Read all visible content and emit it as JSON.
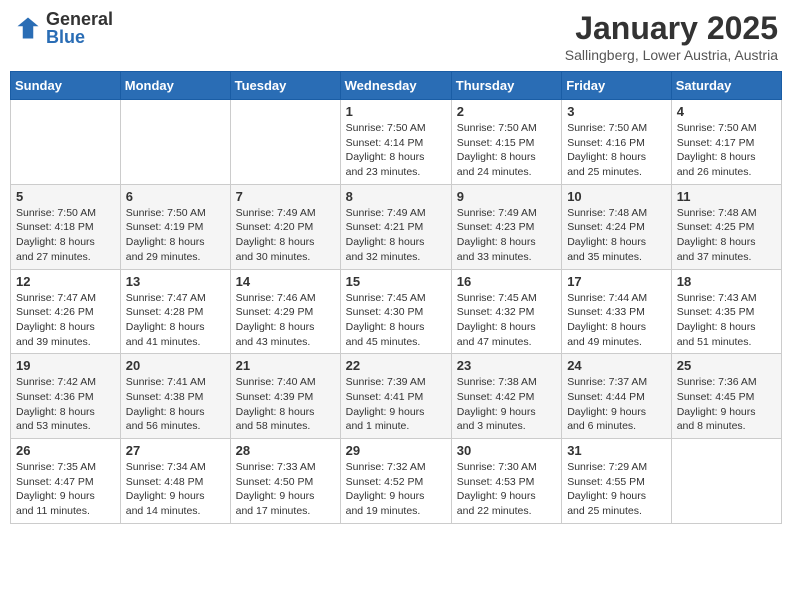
{
  "header": {
    "logo_general": "General",
    "logo_blue": "Blue",
    "month_title": "January 2025",
    "location": "Sallingberg, Lower Austria, Austria"
  },
  "weekdays": [
    "Sunday",
    "Monday",
    "Tuesday",
    "Wednesday",
    "Thursday",
    "Friday",
    "Saturday"
  ],
  "weeks": [
    [
      {
        "day": null,
        "info": null
      },
      {
        "day": null,
        "info": null
      },
      {
        "day": null,
        "info": null
      },
      {
        "day": "1",
        "info": "Sunrise: 7:50 AM\nSunset: 4:14 PM\nDaylight: 8 hours\nand 23 minutes."
      },
      {
        "day": "2",
        "info": "Sunrise: 7:50 AM\nSunset: 4:15 PM\nDaylight: 8 hours\nand 24 minutes."
      },
      {
        "day": "3",
        "info": "Sunrise: 7:50 AM\nSunset: 4:16 PM\nDaylight: 8 hours\nand 25 minutes."
      },
      {
        "day": "4",
        "info": "Sunrise: 7:50 AM\nSunset: 4:17 PM\nDaylight: 8 hours\nand 26 minutes."
      }
    ],
    [
      {
        "day": "5",
        "info": "Sunrise: 7:50 AM\nSunset: 4:18 PM\nDaylight: 8 hours\nand 27 minutes."
      },
      {
        "day": "6",
        "info": "Sunrise: 7:50 AM\nSunset: 4:19 PM\nDaylight: 8 hours\nand 29 minutes."
      },
      {
        "day": "7",
        "info": "Sunrise: 7:49 AM\nSunset: 4:20 PM\nDaylight: 8 hours\nand 30 minutes."
      },
      {
        "day": "8",
        "info": "Sunrise: 7:49 AM\nSunset: 4:21 PM\nDaylight: 8 hours\nand 32 minutes."
      },
      {
        "day": "9",
        "info": "Sunrise: 7:49 AM\nSunset: 4:23 PM\nDaylight: 8 hours\nand 33 minutes."
      },
      {
        "day": "10",
        "info": "Sunrise: 7:48 AM\nSunset: 4:24 PM\nDaylight: 8 hours\nand 35 minutes."
      },
      {
        "day": "11",
        "info": "Sunrise: 7:48 AM\nSunset: 4:25 PM\nDaylight: 8 hours\nand 37 minutes."
      }
    ],
    [
      {
        "day": "12",
        "info": "Sunrise: 7:47 AM\nSunset: 4:26 PM\nDaylight: 8 hours\nand 39 minutes."
      },
      {
        "day": "13",
        "info": "Sunrise: 7:47 AM\nSunset: 4:28 PM\nDaylight: 8 hours\nand 41 minutes."
      },
      {
        "day": "14",
        "info": "Sunrise: 7:46 AM\nSunset: 4:29 PM\nDaylight: 8 hours\nand 43 minutes."
      },
      {
        "day": "15",
        "info": "Sunrise: 7:45 AM\nSunset: 4:30 PM\nDaylight: 8 hours\nand 45 minutes."
      },
      {
        "day": "16",
        "info": "Sunrise: 7:45 AM\nSunset: 4:32 PM\nDaylight: 8 hours\nand 47 minutes."
      },
      {
        "day": "17",
        "info": "Sunrise: 7:44 AM\nSunset: 4:33 PM\nDaylight: 8 hours\nand 49 minutes."
      },
      {
        "day": "18",
        "info": "Sunrise: 7:43 AM\nSunset: 4:35 PM\nDaylight: 8 hours\nand 51 minutes."
      }
    ],
    [
      {
        "day": "19",
        "info": "Sunrise: 7:42 AM\nSunset: 4:36 PM\nDaylight: 8 hours\nand 53 minutes."
      },
      {
        "day": "20",
        "info": "Sunrise: 7:41 AM\nSunset: 4:38 PM\nDaylight: 8 hours\nand 56 minutes."
      },
      {
        "day": "21",
        "info": "Sunrise: 7:40 AM\nSunset: 4:39 PM\nDaylight: 8 hours\nand 58 minutes."
      },
      {
        "day": "22",
        "info": "Sunrise: 7:39 AM\nSunset: 4:41 PM\nDaylight: 9 hours\nand 1 minute."
      },
      {
        "day": "23",
        "info": "Sunrise: 7:38 AM\nSunset: 4:42 PM\nDaylight: 9 hours\nand 3 minutes."
      },
      {
        "day": "24",
        "info": "Sunrise: 7:37 AM\nSunset: 4:44 PM\nDaylight: 9 hours\nand 6 minutes."
      },
      {
        "day": "25",
        "info": "Sunrise: 7:36 AM\nSunset: 4:45 PM\nDaylight: 9 hours\nand 8 minutes."
      }
    ],
    [
      {
        "day": "26",
        "info": "Sunrise: 7:35 AM\nSunset: 4:47 PM\nDaylight: 9 hours\nand 11 minutes."
      },
      {
        "day": "27",
        "info": "Sunrise: 7:34 AM\nSunset: 4:48 PM\nDaylight: 9 hours\nand 14 minutes."
      },
      {
        "day": "28",
        "info": "Sunrise: 7:33 AM\nSunset: 4:50 PM\nDaylight: 9 hours\nand 17 minutes."
      },
      {
        "day": "29",
        "info": "Sunrise: 7:32 AM\nSunset: 4:52 PM\nDaylight: 9 hours\nand 19 minutes."
      },
      {
        "day": "30",
        "info": "Sunrise: 7:30 AM\nSunset: 4:53 PM\nDaylight: 9 hours\nand 22 minutes."
      },
      {
        "day": "31",
        "info": "Sunrise: 7:29 AM\nSunset: 4:55 PM\nDaylight: 9 hours\nand 25 minutes."
      },
      {
        "day": null,
        "info": null
      }
    ]
  ]
}
